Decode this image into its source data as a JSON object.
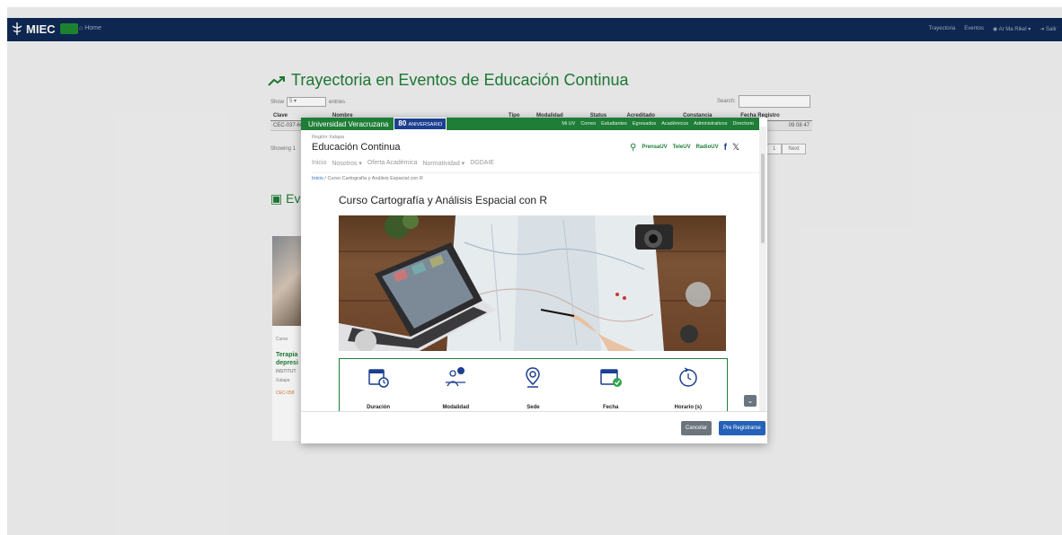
{
  "nav": {
    "brand": "MIEC",
    "home": "Home",
    "right_links": [
      "Trayectoria",
      "Eventos"
    ],
    "user": "Ar Ma Rikel",
    "logout": "Salir"
  },
  "page": {
    "title": "Trayectoria en Eventos de Educación Continua",
    "show_label": "Show",
    "show_value": "5",
    "entries_label": "entries",
    "search_label": "Search:",
    "columns": [
      "Clave",
      "Nombre",
      "Tipo",
      "Modalidad",
      "Status",
      "Acreditado",
      "Constancia",
      "Fecha Registro"
    ],
    "row": {
      "clave": "CEC-037-60",
      "fecha": "09 08 47"
    },
    "showing": "Showing 1",
    "pager_next": "Next",
    "pager_page": "1",
    "section2_title": "Ev"
  },
  "card": {
    "type": "Curso",
    "title": "Terapia depresi",
    "institution": "INSTITUT",
    "location": "Xalapa",
    "code": "CEC-058"
  },
  "modal": {
    "uv_name": "Universidad Veracruzana",
    "anniversary_num": "80",
    "anniversary_text": "ANIVERSARIO",
    "top_links": [
      "Mi UV",
      "Correo",
      "Estudiantes",
      "Egresados",
      "Académicos",
      "Administrativos",
      "Directorio"
    ],
    "region": "Región Xalapa",
    "site_title": "Educación Continua",
    "media_links": [
      "PrensaUV",
      "TeleUV",
      "RadioUV"
    ],
    "menu": [
      "Inicio",
      "Nosotros",
      "Oferta Académica",
      "Normatividad",
      "DGDAIE"
    ],
    "breadcrumb_home": "Inicio",
    "breadcrumb_current": "Curso Cartografía y Análisis Espacial con R",
    "course_title": "Curso Cartografía y Análisis Espacial con R",
    "info_labels": [
      "Duración",
      "Modalidad",
      "Sede",
      "Fecha",
      "Horario (s)"
    ],
    "cancel_label": "Cancelar",
    "register_label": "Pre Registrarse"
  },
  "colors": {
    "nav_bg": "#0f2a55",
    "uv_green": "#1e7d36",
    "primary": "#2661b8"
  }
}
